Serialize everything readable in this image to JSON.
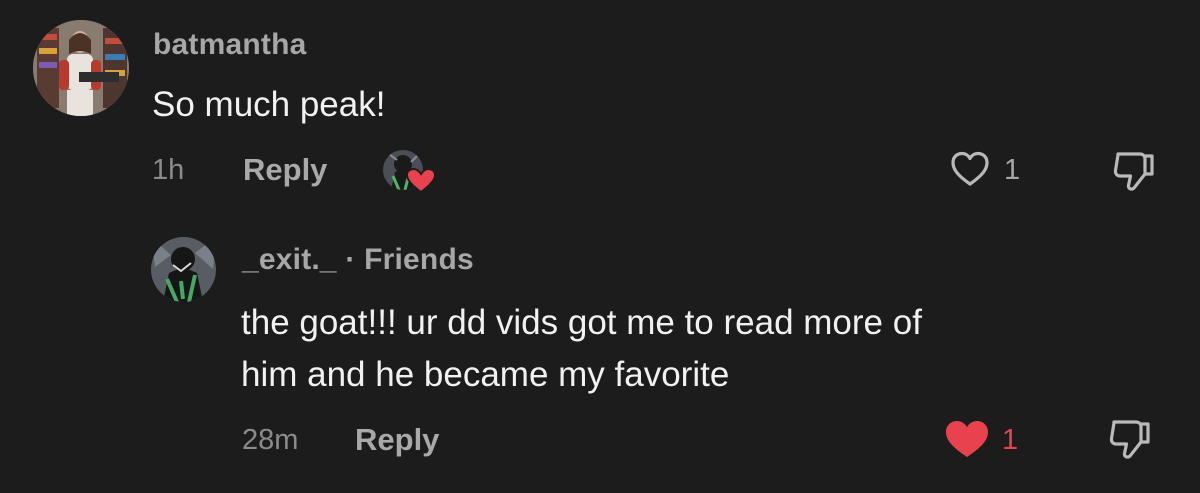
{
  "comments": [
    {
      "username": "batmantha",
      "text": "So much peak!",
      "time": "1h",
      "reply_label": "Reply",
      "likes": "1",
      "liked": false
    },
    {
      "username": "_exit._",
      "separator": "·",
      "tag": "Friends",
      "text_line1": "the goat!!! ur dd vids got me to read more of",
      "text_line2": "him and he became my favorite",
      "time": "28m",
      "reply_label": "Reply",
      "likes": "1",
      "liked": true
    }
  ],
  "colors": {
    "background": "#1c1c1d",
    "like_active": "#e8424e",
    "muted_text": "#a7a7a8"
  }
}
